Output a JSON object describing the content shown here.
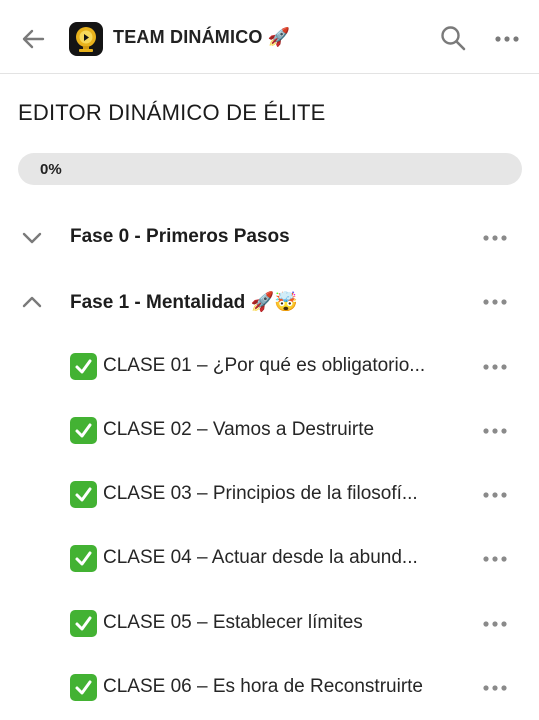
{
  "header": {
    "title": "TEAM DINÁMICO 🚀",
    "back_icon": "arrow-left-icon",
    "logo_icon": "trophy-app-logo",
    "search_icon": "search-icon",
    "more_icon": "more-horizontal-icon"
  },
  "course": {
    "title": "EDITOR DINÁMICO DE ÉLITE",
    "progress_percent": 0,
    "progress_label": "0%"
  },
  "sections": [
    {
      "title": "Fase 0 - Primeros Pasos",
      "expanded": false,
      "icon": "chevron-down-icon"
    },
    {
      "title": "Fase 1 - Mentalidad 🚀🤯",
      "expanded": true,
      "icon": "chevron-up-icon",
      "lessons": [
        {
          "title": "CLASE 01 – ¿Por qué es obligatorio...",
          "completed": true
        },
        {
          "title": "CLASE 02 – Vamos a Destruirte",
          "completed": true
        },
        {
          "title": "CLASE 03 – Principios de la filosofí...",
          "completed": true
        },
        {
          "title": "CLASE 04 – Actuar desde la abund...",
          "completed": true
        },
        {
          "title": "CLASE 05 – Establecer límites",
          "completed": true
        },
        {
          "title": "CLASE 06 – Es hora de Reconstruirte",
          "completed": true
        }
      ]
    }
  ],
  "colors": {
    "check_green": "#43b233",
    "progress_track": "#e6e6e6",
    "icon_gray": "#7a7a7a"
  }
}
